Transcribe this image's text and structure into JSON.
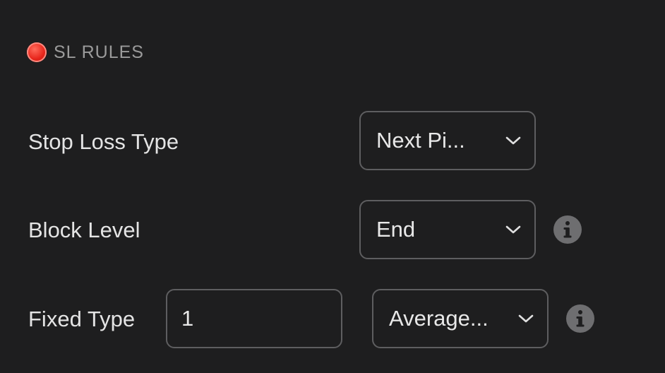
{
  "section": {
    "title": "SL RULES",
    "icon": "stop-sign-icon",
    "icon_color": "#e8261c"
  },
  "rows": {
    "stop_loss_type": {
      "label": "Stop Loss Type",
      "selected": "Next Pi..."
    },
    "block_level": {
      "label": "Block Level",
      "selected": "End"
    },
    "fixed_type": {
      "label": "Fixed Type",
      "input_value": "1",
      "selected": "Average..."
    }
  },
  "colors": {
    "background": "#1e1e1f",
    "border": "#5e5e60",
    "text": "#e4e4e4",
    "muted": "#9b9b9b",
    "info_icon": "#6e6e70"
  }
}
